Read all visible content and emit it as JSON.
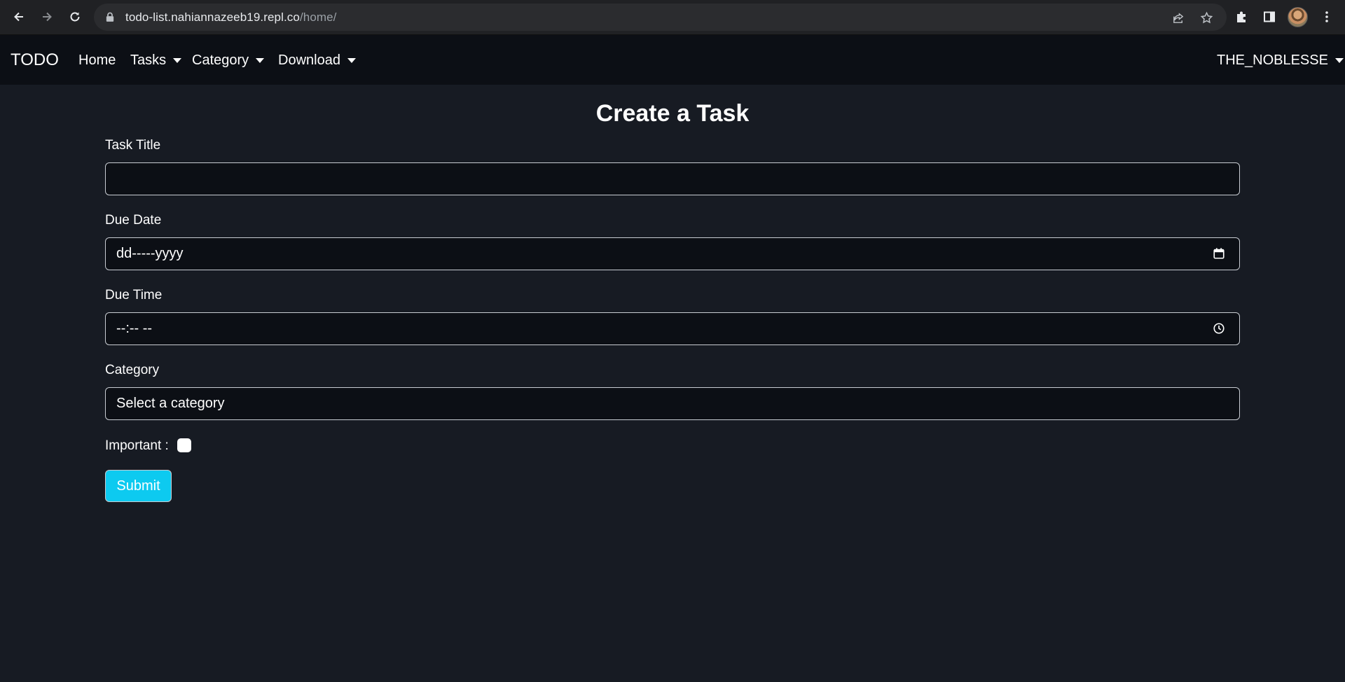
{
  "browser": {
    "url_host": "todo-list.nahiannazeeb19.repl.co",
    "url_path": "/home/"
  },
  "navbar": {
    "brand": "TODO",
    "items": [
      {
        "label": "Home",
        "dropdown": false
      },
      {
        "label": "Tasks",
        "dropdown": true
      },
      {
        "label": "Category",
        "dropdown": true
      },
      {
        "label": "Download",
        "dropdown": true
      }
    ],
    "user": "THE_NOBLESSE"
  },
  "form": {
    "title": "Create a Task",
    "task_title_label": "Task Title",
    "task_title_value": "",
    "due_date_label": "Due Date",
    "due_date_value": "dd-----yyyy",
    "due_time_label": "Due Time",
    "due_time_value": "--:-- --",
    "category_label": "Category",
    "category_value": "Select a category",
    "important_label": "Important :",
    "important_checked": false,
    "submit_label": "Submit"
  },
  "colors": {
    "page_bg": "#171b23",
    "navbar_bg": "#0c0f15",
    "submit_bg": "#0dcaf0"
  }
}
